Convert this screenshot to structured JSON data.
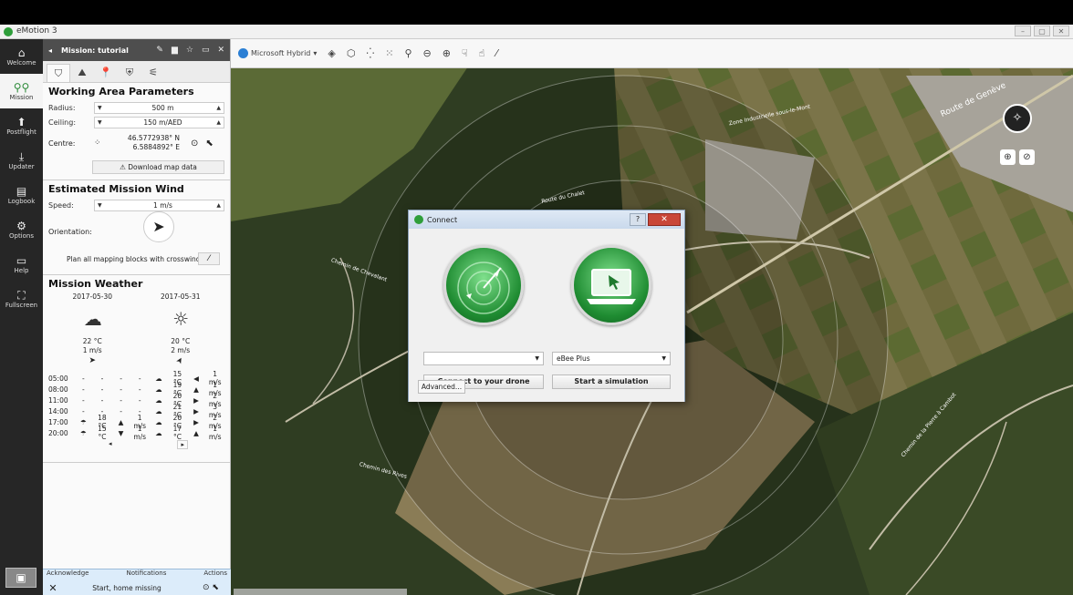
{
  "app": {
    "title": "eMotion 3"
  },
  "sidebar": {
    "items": [
      {
        "label": "Welcome",
        "icon": "⌂"
      },
      {
        "label": "Mission",
        "icon": "⚲⚲"
      },
      {
        "label": "Postflight",
        "icon": "⬆"
      },
      {
        "label": "Updater",
        "icon": "⤓"
      },
      {
        "label": "Logbook",
        "icon": "▤"
      },
      {
        "label": "Options",
        "icon": "⚙"
      },
      {
        "label": "Help",
        "icon": "▭"
      },
      {
        "label": "Fullscreen",
        "icon": "⛶"
      }
    ],
    "bottom_label": "Connect"
  },
  "panel": {
    "title": "Mission: tutorial",
    "working_area": {
      "title": "Working Area Parameters",
      "radius_label": "Radius:",
      "radius_value": "500 m",
      "ceiling_label": "Ceiling:",
      "ceiling_value": "150 m/AED",
      "centre_label": "Centre:",
      "centre_lat": "46.5772938° N",
      "centre_lon": "6.5884892° E",
      "download_label": "⚠ Download map data"
    },
    "wind": {
      "title": "Estimated Mission Wind",
      "speed_label": "Speed:",
      "speed_value": "1 m/s",
      "orientation_label": "Orientation:",
      "crosswind_label": "Plan all mapping blocks with crosswind"
    },
    "weather": {
      "title": "Mission Weather",
      "dates": [
        "2017-05-30",
        "2017-05-31"
      ],
      "days": [
        {
          "temp": "22 °C",
          "wind": "1 m/s",
          "arrow": "➤"
        },
        {
          "temp": "20 °C",
          "wind": "2 m/s",
          "arrow": "➤"
        }
      ],
      "hourly": [
        {
          "time": "05:00",
          "cells": [
            "-",
            "-",
            "-",
            "-",
            "☁",
            "15 °C",
            "◀",
            "1 m/s"
          ]
        },
        {
          "time": "08:00",
          "cells": [
            "-",
            "-",
            "-",
            "-",
            "☁",
            "19 °C",
            "▲",
            "1 m/s"
          ]
        },
        {
          "time": "11:00",
          "cells": [
            "-",
            "-",
            "-",
            "-",
            "☁",
            "20 °C",
            "▶",
            "2 m/s"
          ]
        },
        {
          "time": "14:00",
          "cells": [
            "-",
            "-",
            "-",
            "-",
            "☁",
            "21 °C",
            "▶",
            "3 m/s"
          ]
        },
        {
          "time": "17:00",
          "cells": [
            "☂",
            "18 °C",
            "▲",
            "1 m/s",
            "☁",
            "20 °C",
            "▶",
            "2 m/s"
          ]
        },
        {
          "time": "20:00",
          "cells": [
            "☂",
            "15 °C",
            "▼",
            "1 m/s",
            "☁",
            "17 °C",
            "▲",
            "1 m/s"
          ]
        }
      ]
    }
  },
  "notifications": {
    "acknowledge": "Acknowledge",
    "notifications": "Notifications",
    "actions": "Actions",
    "message": "Start, home missing"
  },
  "map": {
    "layer_label": "Microsoft Hybrid",
    "labels": [
      "Route de Genève",
      "Route du Chalet",
      "Chemin de la Pierre à Cambot",
      "Zone Industrielle sous-le-Mont",
      "Chemin des Rives",
      "Chemin de Chevalant"
    ]
  },
  "dialog": {
    "title": "Connect",
    "drone_select": "",
    "drone_type": "eBee Plus",
    "connect_label": "Connect to your drone",
    "simulate_label": "Start a simulation",
    "advanced_label": "Advanced..."
  },
  "colors": {
    "accent_green": "#2e9e3a",
    "sidebar_dark": "#262626",
    "notification_bg": "#dcecfa"
  }
}
